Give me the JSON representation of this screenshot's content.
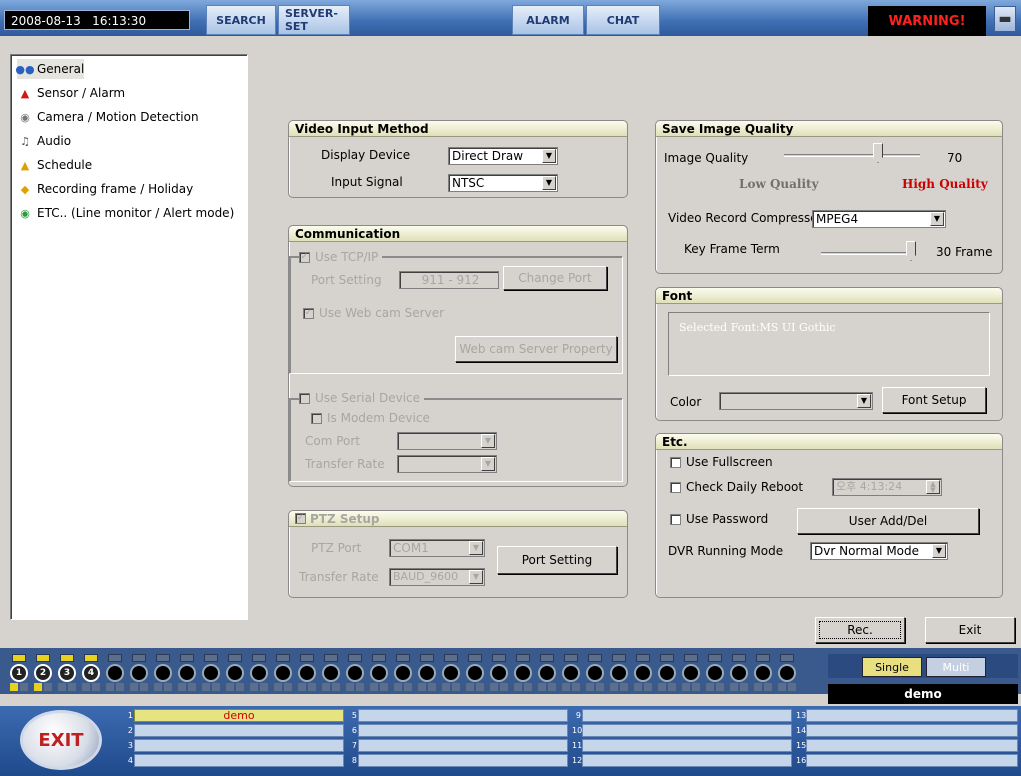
{
  "topbar": {
    "datetime": "2008-08-13   16:13:30",
    "search": "SEARCH",
    "server_set": "SERVER-SET",
    "alarm": "ALARM",
    "chat": "CHAT",
    "warning": "WARNING!"
  },
  "tree": {
    "items": [
      {
        "label": "General",
        "icon": "users-icon"
      },
      {
        "label": "Sensor / Alarm",
        "icon": "siren-icon"
      },
      {
        "label": "Camera / Motion Detection",
        "icon": "camera-icon"
      },
      {
        "label": "Audio",
        "icon": "microphone-icon"
      },
      {
        "label": "Schedule",
        "icon": "bell-icon"
      },
      {
        "label": "Recording frame / Holiday",
        "icon": "diamond-icon"
      },
      {
        "label": "ETC.. (Line monitor / Alert mode)",
        "icon": "globe-icon"
      }
    ]
  },
  "video_input": {
    "title": "Video Input Method",
    "display_device_label": "Display Device",
    "display_device_value": "Direct Draw",
    "input_signal_label": "Input Signal",
    "input_signal_value": "NTSC"
  },
  "communication": {
    "title": "Communication",
    "use_tcpip": "Use TCP/IP",
    "port_setting_label": "Port Setting",
    "port_setting_value": "911 - 912",
    "change_port": "Change Port",
    "use_webcam": "Use Web cam Server",
    "webcam_property": "Web cam Server Property",
    "use_serial": "Use Serial Device",
    "is_modem": "Is Modem Device",
    "com_port_label": "Com Port",
    "transfer_rate_label": "Transfer Rate"
  },
  "ptz": {
    "title": "PTZ Setup",
    "ptz_port_label": "PTZ Port",
    "ptz_port_value": "COM1",
    "transfer_rate_label": "Transfer Rate",
    "transfer_rate_value": "BAUD_9600",
    "port_setting": "Port Setting"
  },
  "save_quality": {
    "title": "Save Image Quality",
    "image_quality_label": "Image Quality",
    "image_quality_value": "70",
    "low": "Low Quality",
    "high": "High Quality",
    "compressor_label": "Video Record Compressor",
    "compressor_value": "MPEG4",
    "keyframe_label": "Key Frame Term",
    "keyframe_value": "30 Frame"
  },
  "font": {
    "title": "Font",
    "selected": "Selected Font:MS UI Gothic",
    "color_label": "Color",
    "font_setup": "Font Setup"
  },
  "etc": {
    "title": "Etc.",
    "use_fullscreen": "Use Fullscreen",
    "check_daily_reboot": "Check Daily Reboot",
    "reboot_time": "오후  4:13:24",
    "use_password": "Use Password",
    "user_add_del": "User Add/Del",
    "dvr_mode_label": "DVR Running Mode",
    "dvr_mode_value": "Dvr Normal Mode"
  },
  "actions": {
    "rec": "Rec.",
    "exit": "Exit"
  },
  "channels": {
    "cam_labels": [
      "1",
      "2",
      "3",
      "4"
    ],
    "single": "Single",
    "multi": "Multi",
    "user": "demo"
  },
  "bottom": {
    "exit": "EXIT",
    "cells": [
      {
        "num": "1",
        "text": "demo"
      },
      {
        "num": "2",
        "text": ""
      },
      {
        "num": "3",
        "text": ""
      },
      {
        "num": "4",
        "text": ""
      },
      {
        "num": "5",
        "text": ""
      },
      {
        "num": "6",
        "text": ""
      },
      {
        "num": "7",
        "text": ""
      },
      {
        "num": "8",
        "text": ""
      },
      {
        "num": "9",
        "text": ""
      },
      {
        "num": "10",
        "text": ""
      },
      {
        "num": "11",
        "text": ""
      },
      {
        "num": "12",
        "text": ""
      },
      {
        "num": "13",
        "text": ""
      },
      {
        "num": "14",
        "text": ""
      },
      {
        "num": "15",
        "text": ""
      },
      {
        "num": "16",
        "text": ""
      }
    ]
  },
  "colors": {
    "warning": "#ff2020",
    "high_quality": "#cc0000",
    "group_header": "#dfe0b8"
  }
}
